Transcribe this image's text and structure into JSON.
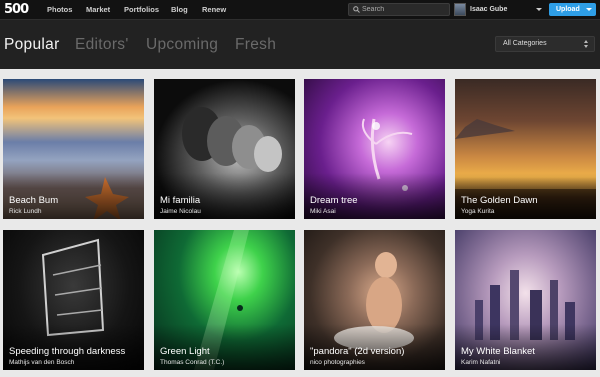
{
  "header": {
    "logo": "500",
    "nav": [
      "Photos",
      "Market",
      "Portfolios",
      "Blog",
      "Renew"
    ],
    "search_placeholder": "Search",
    "user_name": "Isaac Gube",
    "upload_label": "Upload"
  },
  "tabs": [
    {
      "label": "Popular",
      "active": true
    },
    {
      "label": "Editors'",
      "active": false
    },
    {
      "label": "Upcoming",
      "active": false
    },
    {
      "label": "Fresh",
      "active": false
    }
  ],
  "category_select": "All Categories",
  "photos": [
    {
      "title": "Beach Bum",
      "author": "Rick Lundh"
    },
    {
      "title": "Mi familia",
      "author": "Jaime Nicolau"
    },
    {
      "title": "Dream tree",
      "author": "Miki Asai"
    },
    {
      "title": "The Golden Dawn",
      "author": "Yoga Kurita"
    },
    {
      "title": "Speeding through darkness",
      "author": "Mathijs van den Bosch"
    },
    {
      "title": "Green Light",
      "author": "Thomas Conrad (T.C.)"
    },
    {
      "title": "\"pandora\" (2d version)",
      "author": "nico photographies"
    },
    {
      "title": "My White Blanket",
      "author": "Karim Nafatni"
    }
  ],
  "colors": {
    "topbar": "#121212",
    "subbar": "#222222",
    "upload_button": "#2e9ee6",
    "grid_background": "#e9e9e9"
  }
}
